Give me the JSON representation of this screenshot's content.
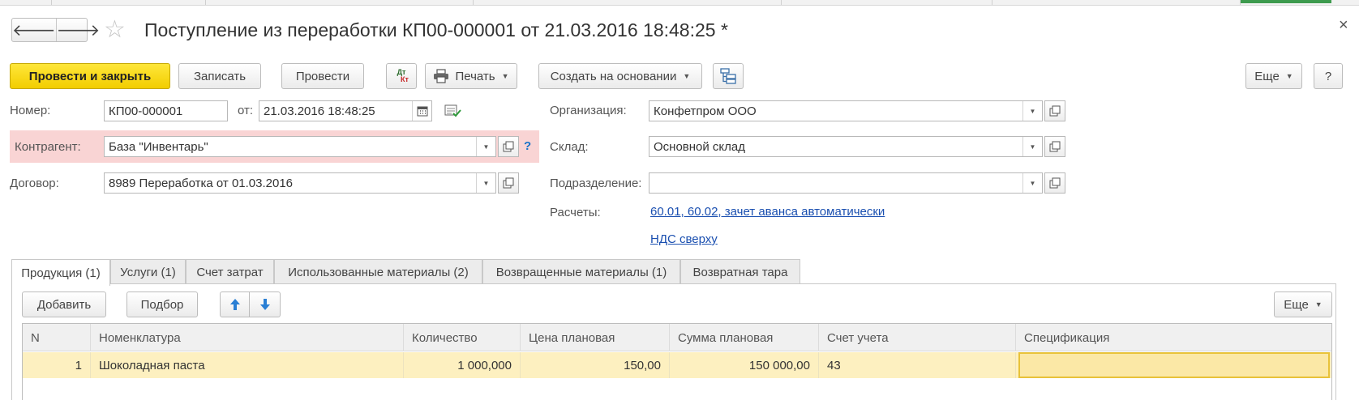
{
  "window": {
    "title": "Поступление из переработки КП00-000001 от 21.03.2016 18:48:25 *",
    "nav_back": "🡐",
    "nav_forward": "🡒",
    "favorite_icon": "☆",
    "close_icon": "×"
  },
  "toolbar": {
    "post_and_close": "Провести и закрыть",
    "save": "Записать",
    "post": "Провести",
    "dt_kt_top": "Дт",
    "dt_kt_bottom": "Кт",
    "print": "Печать",
    "create_based_on": "Создать на основании",
    "more": "Еще",
    "help": "?"
  },
  "form": {
    "number_label": "Номер:",
    "number_value": "КП00-000001",
    "date_label": "от:",
    "date_value": "21.03.2016 18:48:25",
    "counterparty_label": "Контрагент:",
    "counterparty_value": "База \"Инвентарь\"",
    "counterparty_help": "?",
    "contract_label": "Договор:",
    "contract_value": "8989 Переработка от 01.03.2016",
    "organization_label": "Организация:",
    "organization_value": "Конфетпром ООО",
    "warehouse_label": "Склад:",
    "warehouse_value": "Основной склад",
    "department_label": "Подразделение:",
    "department_value": "",
    "settlements_label": "Расчеты:",
    "settlements_link": "60.01, 60.02, зачет аванса автоматически",
    "vat_link": "НДС сверху"
  },
  "tabs": [
    {
      "label": "Продукция (1)",
      "active": true
    },
    {
      "label": "Услуги (1)",
      "active": false
    },
    {
      "label": "Счет затрат",
      "active": false
    },
    {
      "label": "Использованные материалы (2)",
      "active": false
    },
    {
      "label": "Возвращенные материалы (1)",
      "active": false
    },
    {
      "label": "Возвратная тара",
      "active": false
    }
  ],
  "table_toolbar": {
    "add": "Добавить",
    "pick": "Подбор",
    "more": "Еще"
  },
  "table": {
    "columns": [
      "N",
      "Номенклатура",
      "Количество",
      "Цена плановая",
      "Сумма плановая",
      "Счет учета",
      "Спецификация"
    ],
    "rows": [
      [
        "1",
        "Шоколадная паста",
        "1 000,000",
        "150,00",
        "150 000,00",
        "43",
        ""
      ]
    ]
  },
  "colors": {
    "primary_button": "#f5d400",
    "counterparty_highlight": "#f9d4d4",
    "link": "#1a4fb0",
    "selected_row": "#fdf0c0"
  }
}
